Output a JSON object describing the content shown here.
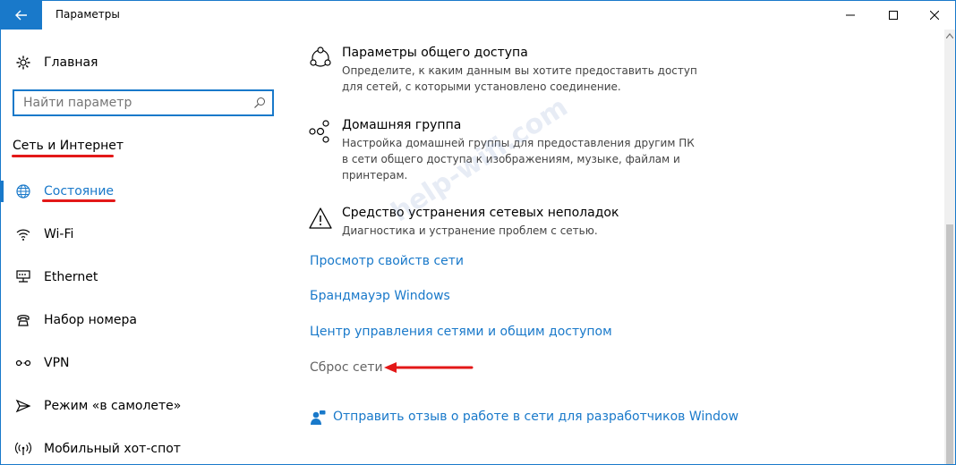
{
  "window": {
    "title": "Параметры"
  },
  "sidebar": {
    "home_label": "Главная",
    "search_placeholder": "Найти параметр",
    "section_heading": "Сеть и Интернет",
    "items": [
      {
        "label": "Состояние",
        "icon": "globe-icon",
        "active": true
      },
      {
        "label": "Wi-Fi",
        "icon": "wifi-icon"
      },
      {
        "label": "Ethernet",
        "icon": "ethernet-icon"
      },
      {
        "label": "Набор номера",
        "icon": "dialup-icon"
      },
      {
        "label": "VPN",
        "icon": "vpn-icon"
      },
      {
        "label": "Режим «в самолете»",
        "icon": "airplane-icon"
      },
      {
        "label": "Мобильный хот-спот",
        "icon": "hotspot-icon"
      }
    ]
  },
  "content": {
    "options": [
      {
        "title": "Параметры общего доступа",
        "desc": "Определите, к каким данным вы хотите предоставить доступ для сетей, с которыми установлено соединение.",
        "icon": "sharing-icon"
      },
      {
        "title": "Домашняя группа",
        "desc": "Настройка домашней группы для предоставления другим ПК в сети общего доступа к изображениям, музыке, файлам и принтерам.",
        "icon": "homegroup-icon"
      },
      {
        "title": "Средство устранения сетевых неполадок",
        "desc": "Диагностика и устранение проблем с сетью.",
        "icon": "warning-icon"
      }
    ],
    "links": [
      "Просмотр свойств сети",
      "Брандмауэр Windows",
      "Центр управления сетями и общим доступом",
      "Сброс сети"
    ],
    "feedback_link": "Отправить отзыв о работе в сети для разработчиков Window",
    "watermark": "help-wifi.com"
  },
  "colors": {
    "accent": "#1979ca",
    "annotation_red": "#e31818"
  }
}
